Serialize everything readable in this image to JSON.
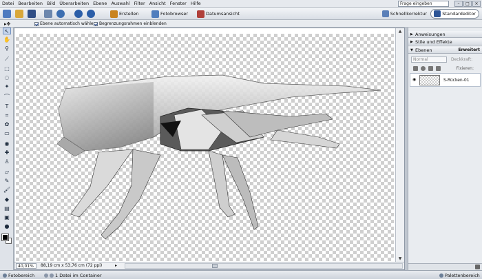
{
  "menu": [
    "Datei",
    "Bearbeiten",
    "Bild",
    "Überarbeiten",
    "Ebene",
    "Auswahl",
    "Filter",
    "Ansicht",
    "Fenster",
    "Hilfe"
  ],
  "help_search": {
    "value": "Frage eingeben"
  },
  "window_buttons": [
    "–",
    "□",
    "×"
  ],
  "shortcuts": {
    "create": "Erstellen",
    "photo_browser": "Fotobrowser",
    "date_view": "Datumsansicht",
    "quick_fix": "Schnellkorrektur",
    "standard_editor": "Standardeditor"
  },
  "options": {
    "auto_select_layer": "Ebene automatisch wählen",
    "show_bounding_box": "Begrenzungsrahmen einblenden"
  },
  "document": {
    "zoom": "40,01%",
    "size": "88,19 cm x 53,76 cm (72 ppi)"
  },
  "palettes": {
    "hints": "Anweisungen",
    "styles_effects": "Stile und Effekte",
    "layers": "Ebenen",
    "layers_more": "Erweitert",
    "blend_mode": "Normal",
    "opacity_label": "Deckkraft:",
    "fix_label": "Fixieren:",
    "layer_name": "S-Rücken-01"
  },
  "statusbar": {
    "photo_bin": "Fotobereich",
    "file_count": "1 Datei im Container",
    "palette_bin": "Palettenbereich"
  },
  "colors": {
    "accent": "#1a3f8a",
    "fg": "#000000",
    "bg": "#ffffff"
  }
}
